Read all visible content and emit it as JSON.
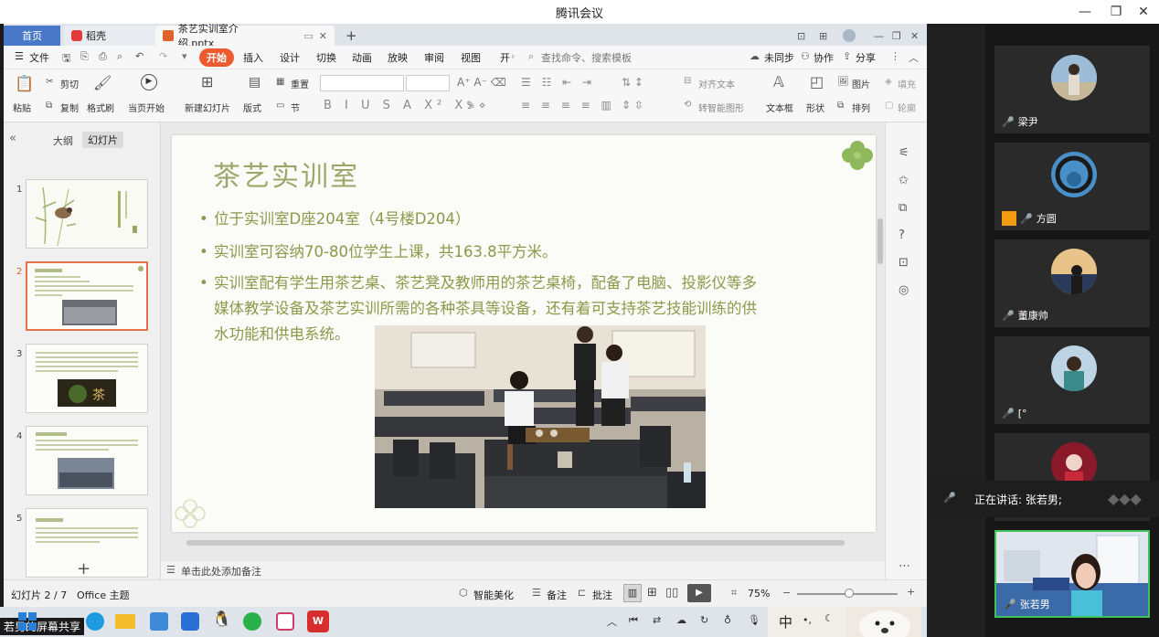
{
  "window": {
    "title": "腾讯会议"
  },
  "wps": {
    "tabs": {
      "home": "首页",
      "wps_brand": "稻壳",
      "doc": "茶艺实训室介绍.pptx"
    },
    "menu": [
      "文件",
      "开始",
      "插入",
      "设计",
      "切换",
      "动画",
      "放映",
      "审阅",
      "视图",
      "开"
    ],
    "search_placeholder": "查找命令、搜索模板",
    "menu_right": {
      "sync": "未同步",
      "collab": "协作",
      "share": "分享"
    },
    "ribbon": {
      "paste": "粘贴",
      "cut": "剪切",
      "copy": "复制",
      "format_painter": "格式刷",
      "from_current": "当页开始",
      "new_slide": "新建幻灯片",
      "layout": "版式",
      "section": "节",
      "reset": "重置",
      "align_text": "对齐文本",
      "smartart": "转智能图形",
      "textbox": "文本框",
      "shape": "形状",
      "picture": "图片",
      "arrange": "排列",
      "fill": "填充",
      "outline": "轮廓"
    },
    "panel_tabs": {
      "outline": "大纲",
      "slides": "幻灯片"
    },
    "thumbs": [
      "1",
      "2",
      "3",
      "4",
      "5"
    ],
    "slide": {
      "title": "茶艺实训室",
      "bullets": [
        "位于实训室D座204室（4号楼D204）",
        "实训室可容纳70-80位学生上课，共163.8平方米。",
        "实训室配有学生用茶艺桌、茶艺凳及教师用的茶艺桌椅，配备了电脑、投影仪等多",
        "媒体教学设备及茶艺实训所需的各种茶具等设备，还有着可支持茶艺技能训练的供",
        "水功能和供电系统。"
      ]
    },
    "notes_hint": "单击此处添加备注",
    "status": {
      "slide_counter": "幻灯片 2 / 7",
      "theme": "Office 主题",
      "beautify": "智能美化",
      "notes": "备注",
      "comments": "批注",
      "zoom": "75%"
    }
  },
  "taskbar": {
    "ime": "中",
    "share_label": "若男的屏幕共享"
  },
  "meeting": {
    "participants": [
      {
        "name": "梁尹"
      },
      {
        "name": "方圆"
      },
      {
        "name": "董康帅"
      },
      {
        "name": "[°"
      },
      {
        "name": ""
      },
      {
        "name": "张若男"
      }
    ],
    "speaking": "正在讲话: 张若男;"
  }
}
